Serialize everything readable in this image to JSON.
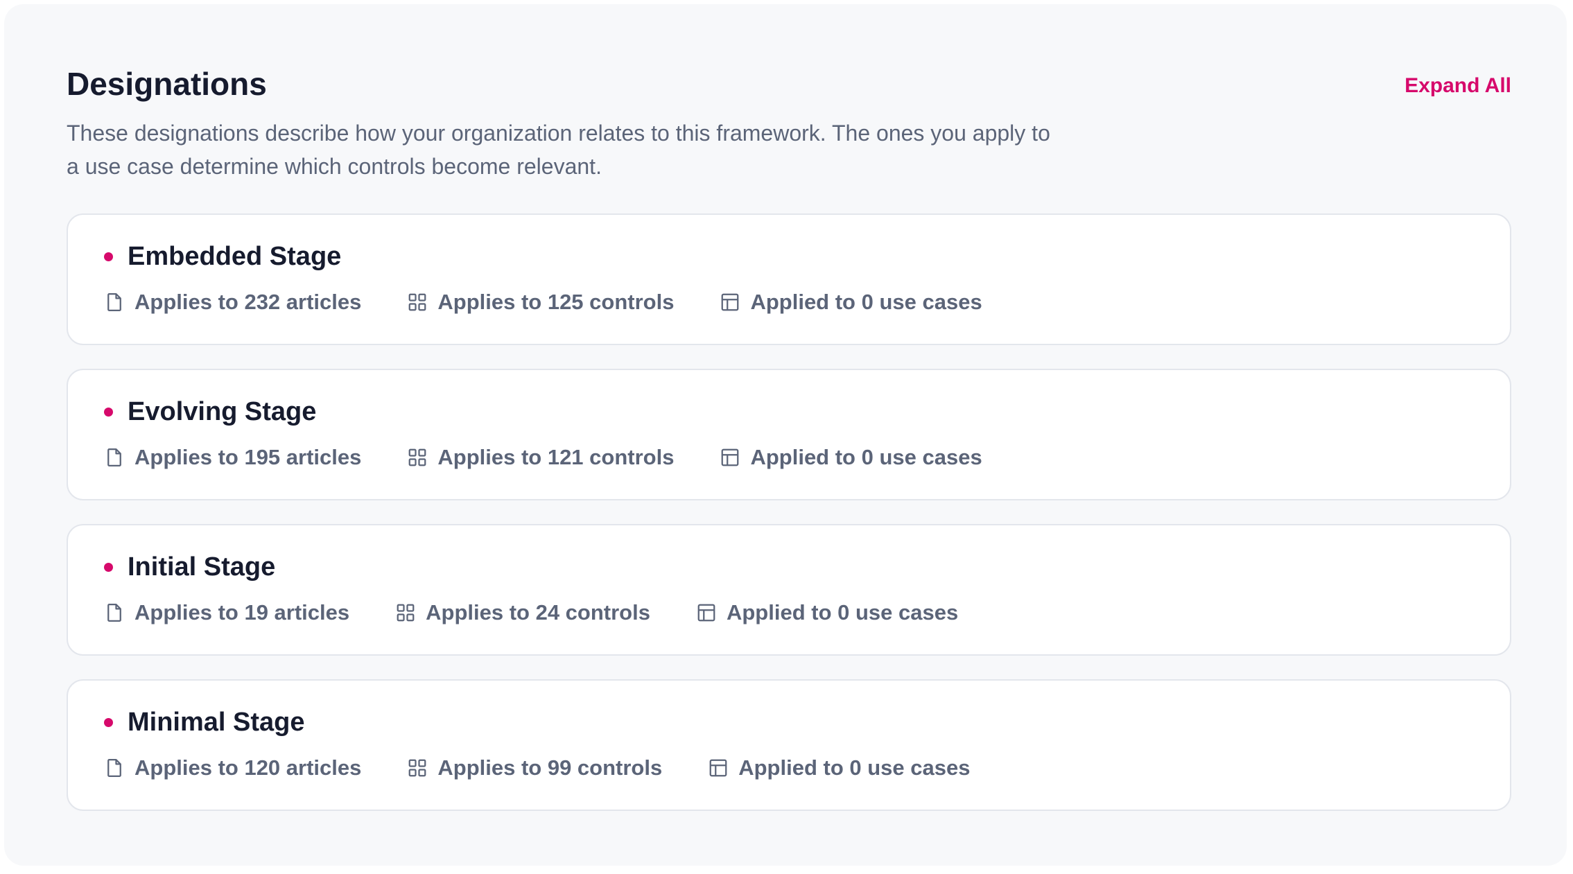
{
  "header": {
    "title": "Designations",
    "description": "These designations describe how your organization relates to this framework. The ones you apply to a use case determine which controls become relevant.",
    "expand_all_label": "Expand All"
  },
  "colors": {
    "accent": "#d6096b",
    "heading": "#161b2e",
    "muted": "#5b6478",
    "card_border": "#e3e6ec",
    "panel_bg": "#f7f8fa"
  },
  "icons": {
    "articles": "document-icon",
    "controls": "grid-icon",
    "use_cases": "layout-icon"
  },
  "designations": [
    {
      "name": "Embedded Stage",
      "articles": "Applies to 232 articles",
      "controls": "Applies to 125 controls",
      "use_cases": "Applied to 0 use cases"
    },
    {
      "name": "Evolving Stage",
      "articles": "Applies to 195 articles",
      "controls": "Applies to 121 controls",
      "use_cases": "Applied to 0 use cases"
    },
    {
      "name": "Initial Stage",
      "articles": "Applies to 19 articles",
      "controls": "Applies to 24 controls",
      "use_cases": "Applied to 0 use cases"
    },
    {
      "name": "Minimal Stage",
      "articles": "Applies to 120 articles",
      "controls": "Applies to 99 controls",
      "use_cases": "Applied to 0 use cases"
    }
  ]
}
